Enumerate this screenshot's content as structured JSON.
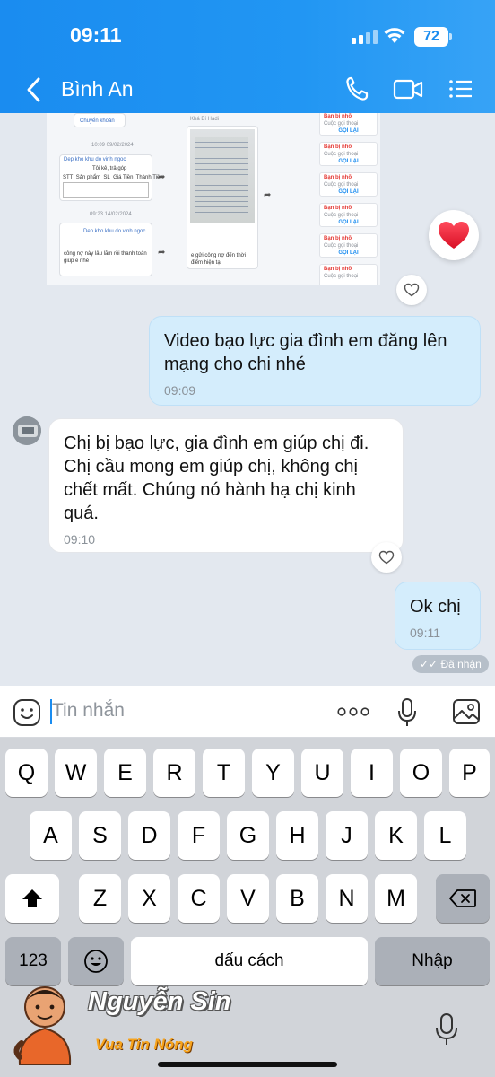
{
  "status_bar": {
    "time": "09:11",
    "battery": "72"
  },
  "header": {
    "contact_name": "Bình An"
  },
  "media_preview": {
    "card1_button": "Chuyển khoản",
    "card1_date1": "10:09 09/02/2024",
    "card1_date2": "09:23 14/02/2024",
    "card1_sender": "Dep kho khu do vinh ngoc",
    "card1_table_title": "Tôi kê, trả góp",
    "card1_table_headers": [
      "STT",
      "Sản phẩm",
      "SL",
      "Giá Tiền",
      "Thành Tiền"
    ],
    "card1_caption": "công nợ này lâu lắm rồi thanh toán giúp e nhé",
    "card2_sender": "Khá Bí Hadi",
    "card2_caption": "e gửi công nợ đến thời điểm hiện tại",
    "call_cards": [
      {
        "title": "Bạn bị nhỡ",
        "subtitle": "Cuộc gọi thoại",
        "action": "GỌI LẠI"
      },
      {
        "title": "Bạn bị nhỡ",
        "subtitle": "Cuộc gọi thoại",
        "action": "GỌI LẠI"
      },
      {
        "title": "Bạn bị nhỡ",
        "subtitle": "Cuộc gọi thoại",
        "action": "GỌI LẠI"
      },
      {
        "title": "Bạn bị nhỡ",
        "subtitle": "Cuộc gọi thoại",
        "action": "GỌI LẠI"
      },
      {
        "title": "Bạn bị nhỡ",
        "subtitle": "Cuộc gọi thoại",
        "action": "GỌI LẠI"
      }
    ]
  },
  "messages": [
    {
      "text": "Video bạo lực gia đình em đăng lên mạng cho chi nhé",
      "time": "09:09"
    },
    {
      "text": "Chị bị bạo lực, gia đình em giúp chị đi. Chị cầu mong em giúp chị, không chị chết mất. Chúng nó hành hạ chị kinh quá.",
      "time": "09:10"
    },
    {
      "text": "Ok chị",
      "time": "09:11"
    }
  ],
  "read_status": "✓✓ Đã nhận",
  "input": {
    "placeholder": "Tin nhắn"
  },
  "keyboard": {
    "row1": [
      "Q",
      "W",
      "E",
      "R",
      "T",
      "Y",
      "U",
      "I",
      "O",
      "P"
    ],
    "row2": [
      "A",
      "S",
      "D",
      "F",
      "G",
      "H",
      "J",
      "K",
      "L"
    ],
    "row3": [
      "Z",
      "X",
      "C",
      "V",
      "B",
      "N",
      "M"
    ],
    "numbers_label": "123",
    "space_label": "dấu cách",
    "return_label": "Nhập"
  },
  "watermark": {
    "name": "Nguyễn Sin",
    "tagline": "Vua Tin Nóng"
  }
}
